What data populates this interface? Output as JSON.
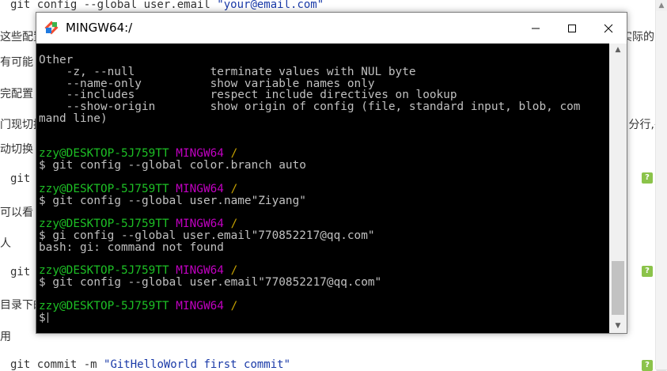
{
  "document": {
    "line_top_code": "git config --global ",
    "line_top_code2": "user.email ",
    "line_top_str": "\"your@email.com\"",
    "frag_1": "这些配置",
    "frag_1_right": "实际的",
    "frag_2": "有可能",
    "frag_3": "完配置",
    "frag_4": "门现切换",
    "frag_4_right": "分行,并",
    "frag_5": "动切换",
    "frag_6_code": "git",
    "frag_7": "可以看",
    "frag_8": "人",
    "frag_9_code": "git",
    "frag_10": "目录下的",
    "frag_11": "用",
    "line_bottom_code": "git commit -m ",
    "line_bottom_str": "\"GitHelloWorld first commit\"",
    "btn_label": "?"
  },
  "window": {
    "title": "MINGW64:/",
    "minimize_glyph": "—",
    "maximize_glyph": "□",
    "close_glyph": "✕"
  },
  "terminal": {
    "help_header": "Other",
    "help_rows": [
      [
        "-z, --null",
        "terminate values with NUL byte"
      ],
      [
        "--name-only",
        "show variable names only"
      ],
      [
        "--includes",
        "respect include directives on lookup"
      ],
      [
        "--show-origin",
        "show origin of config (file, standard input, blob, com"
      ]
    ],
    "wrap_line": "mand line)",
    "user": "zzy@DESKTOP-5J759TT",
    "host": "MINGW64",
    "path": "/",
    "prompt": "$",
    "cmd1": "git config --global color.branch auto",
    "cmd2": "git config --global user.name\"Ziyang\"",
    "cmd3": "gi config --global user.email\"770852217@qq.com\"",
    "cmd3_out": "bash: gi: command not found",
    "cmd4": "git config --global user.email\"770852217@qq.com\""
  }
}
